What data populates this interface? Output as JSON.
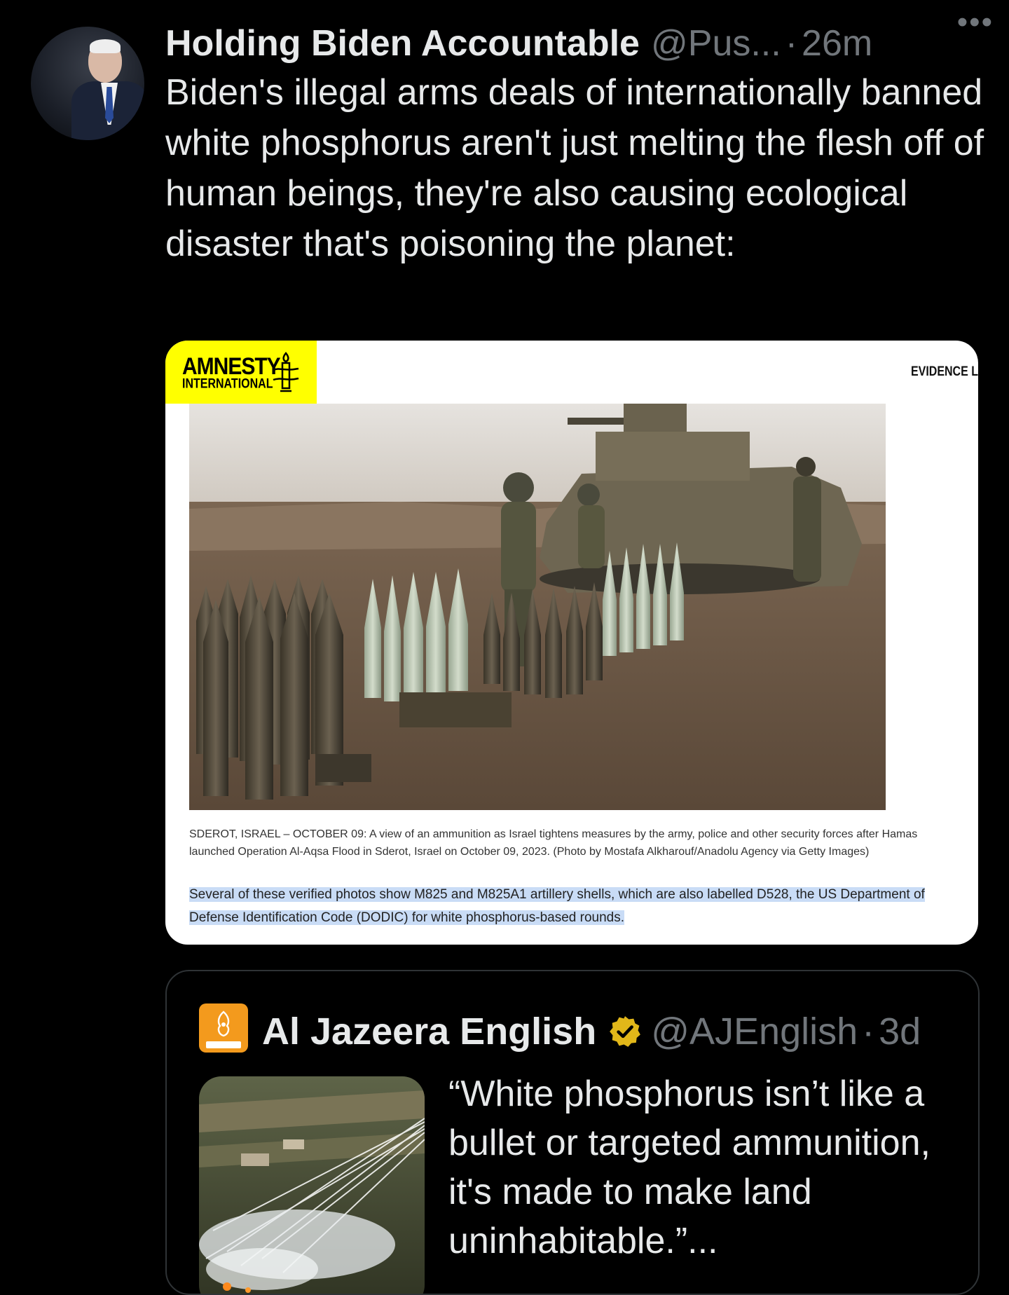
{
  "tweet": {
    "display_name": "Holding Biden Accountable",
    "handle": "@Pus...",
    "separator": "·",
    "timestamp": "26m",
    "more_label": "•••",
    "text": "Biden's illegal arms deals of internationally banned white phosphorus aren't just melting the flesh off of human beings, they're also causing ecological disaster that's poisoning the planet:"
  },
  "media": {
    "logo_line1": "AMNESTY",
    "logo_line2": "INTERNATIONAL",
    "evidence_label": "EVIDENCE L",
    "caption": "SDEROT, ISRAEL – OCTOBER 09: A view of an ammunition as Israel tightens measures by the army, police and other security forces after Hamas launched Operation Al-Aqsa Flood in Sderot, Israel on October 09, 2023. (Photo by Mostafa Alkharouf/Anadolu Agency via Getty Images)",
    "highlighted_text": "Several of these verified photos show M825 and M825A1 artillery shells, which are also labelled D528, the US Department of Defense Identification Code (DODIC) for white phosphorus-based rounds."
  },
  "quote": {
    "display_name": "Al Jazeera English",
    "handle": "@AJEnglish",
    "separator": "·",
    "timestamp": "3d",
    "text": "“White phosphorus isn’t like a bullet or targeted ammunition, it's made to make land uninhabitable.”..."
  },
  "colors": {
    "background": "#000000",
    "text_primary": "#e7e9ea",
    "text_secondary": "#71767b",
    "amnesty_yellow": "#ffff00",
    "highlight": "#c9dcf6",
    "aljazeera_orange": "#f39a1d",
    "verified_gold": "#e2b719"
  }
}
